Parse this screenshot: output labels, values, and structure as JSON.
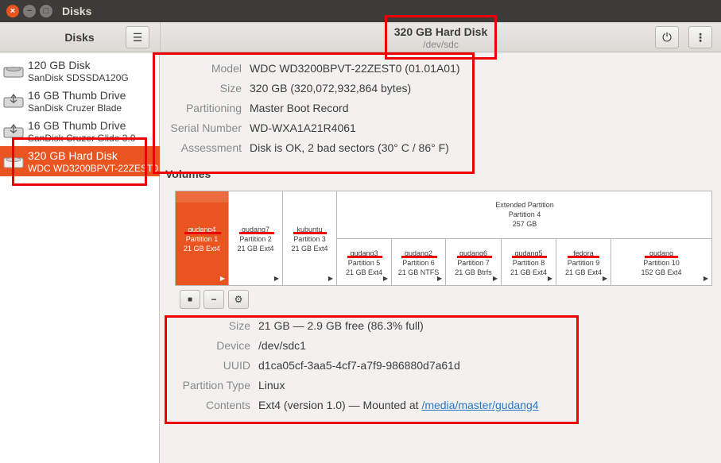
{
  "window": {
    "title": "Disks",
    "close_glyph": "×",
    "min_glyph": "−",
    "max_glyph": "□"
  },
  "sidebar": {
    "title": "Disks",
    "menu_icon": "hamburger-menu-icon",
    "drives": [
      {
        "name": "120 GB Disk",
        "model": "SanDisk SDSSDA120G",
        "icon": "hard-disk-icon"
      },
      {
        "name": "16 GB Thumb Drive",
        "model": "SanDisk Cruzer Blade",
        "icon": "usb-drive-icon"
      },
      {
        "name": "16 GB Thumb Drive",
        "model": "SanDisk Cruzer Glide 3.0",
        "icon": "usb-drive-icon"
      },
      {
        "name": "320 GB Hard Disk",
        "model": "WDC WD3200BPVT-22ZEST0",
        "icon": "hard-disk-icon"
      }
    ]
  },
  "header": {
    "title": "320 GB Hard Disk",
    "subtitle": "/dev/sdc",
    "power_icon": "power-icon",
    "more_icon": "more-vertical-icon",
    "menu_glyph": "☰",
    "power_glyph": "⏻",
    "more_glyph": "⋮"
  },
  "disk_info": {
    "model_label": "Model",
    "model": "WDC WD3200BPVT-22ZEST0 (01.01A01)",
    "size_label": "Size",
    "size": "320 GB (320,072,932,864 bytes)",
    "partitioning_label": "Partitioning",
    "partitioning": "Master Boot Record",
    "serial_label": "Serial Number",
    "serial": "WD-WXA1A21R4061",
    "assessment_label": "Assessment",
    "assessment": "Disk is OK, 2 bad sectors (30° C / 86° F)"
  },
  "volumes": {
    "title": "Volumes",
    "partitions": [
      {
        "name": "gudang4",
        "part": "Partition 1",
        "fs": "21 GB Ext4"
      },
      {
        "name": "gudang7",
        "part": "Partition 2",
        "fs": "21 GB Ext4"
      },
      {
        "name": "kubuntu",
        "part": "Partition 3",
        "fs": "21 GB Ext4"
      }
    ],
    "extended": {
      "name": "Extended Partition",
      "part": "Partition 4",
      "size": "257 GB"
    },
    "logical": [
      {
        "name": "gudang3",
        "part": "Partition 5",
        "fs": "21 GB Ext4"
      },
      {
        "name": "gudang2",
        "part": "Partition 6",
        "fs": "21 GB NTFS"
      },
      {
        "name": "gudang6",
        "part": "Partition 7",
        "fs": "21 GB Btrfs"
      },
      {
        "name": "gudang5",
        "part": "Partition 8",
        "fs": "21 GB Ext4"
      },
      {
        "name": "fedora",
        "part": "Partition 9",
        "fs": "21 GB Ext4"
      },
      {
        "name": "gudang",
        "part": "Partition 10",
        "fs": "152 GB Ext4"
      }
    ],
    "arrow_glyph": "▶",
    "toolbar": {
      "stop_glyph": "■",
      "remove_glyph": "−",
      "settings_glyph": "⚙"
    }
  },
  "partition_info": {
    "size_label": "Size",
    "size": "21 GB — 2.9 GB free (86.3% full)",
    "device_label": "Device",
    "device": "/dev/sdc1",
    "uuid_label": "UUID",
    "uuid": "d1ca05cf-3aa5-4cf7-a7f9-986880d7a61d",
    "ptype_label": "Partition Type",
    "ptype": "Linux",
    "contents_label": "Contents",
    "contents_prefix": "Ext4 (version 1.0) — Mounted at ",
    "mount_link": "/media/master/gudang4"
  },
  "colors": {
    "accent": "#e95420",
    "annotation": "#e00000",
    "link": "#2a76c6"
  }
}
